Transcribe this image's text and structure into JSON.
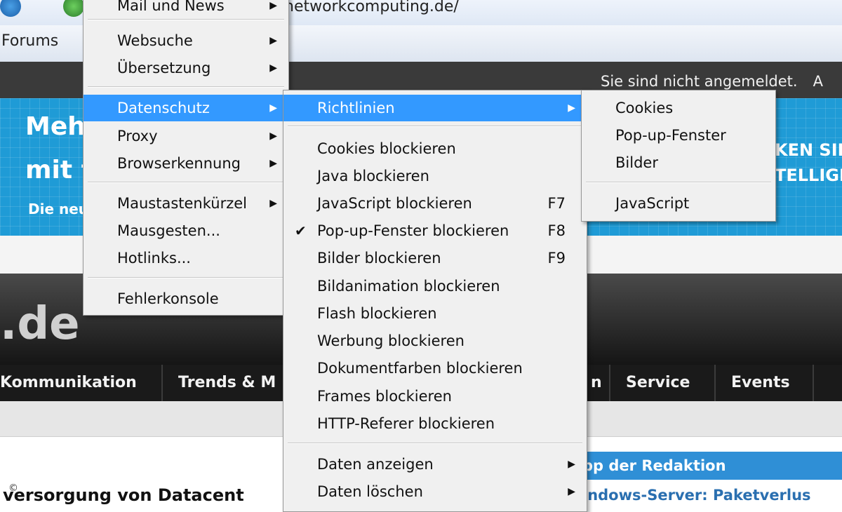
{
  "browser": {
    "address": "networkcomputing.de/",
    "bookmark_label": "Forums"
  },
  "page": {
    "login_status": "Sie sind nicht angemeldet.",
    "login_cut": "A",
    "banner": {
      "line1": "Mehr",
      "line2": "mit f",
      "line3": "Die neu",
      "right1": "KEN SIE,",
      "right2": "TELLIGEN"
    },
    "logo_fragment": ".de",
    "nav": [
      "Kommunikation",
      "Trends & M",
      "n",
      "Service",
      "Events"
    ],
    "headline": "versorgung von Datacent",
    "copyright": "©",
    "tip_header": "pp der Redaktion",
    "tip_text": "indows-Server: Paketverlus"
  },
  "menus": {
    "main": {
      "top_partial": "Mail und News",
      "items": [
        {
          "label": "Websuche",
          "submenu": true
        },
        {
          "label": "Übersetzung",
          "submenu": true
        },
        {
          "label": "Datenschutz",
          "submenu": true,
          "active": true
        },
        {
          "label": "Proxy",
          "submenu": true
        },
        {
          "label": "Browserkennung",
          "submenu": true
        },
        {
          "label": "Maustastenkürzel",
          "submenu": true
        },
        {
          "label": "Mausgesten...",
          "submenu": false
        },
        {
          "label": "Hotlinks...",
          "submenu": false
        },
        {
          "label": "Fehlerkonsole",
          "submenu": false
        }
      ]
    },
    "datenschutz": {
      "items": [
        {
          "label": "Richtlinien",
          "submenu": true,
          "active": true
        },
        {
          "label": "Cookies blockieren"
        },
        {
          "label": "Java blockieren"
        },
        {
          "label": "JavaScript blockieren",
          "shortcut": "F7"
        },
        {
          "label": "Pop-up-Fenster blockieren",
          "shortcut": "F8",
          "checked": true
        },
        {
          "label": "Bilder blockieren",
          "shortcut": "F9"
        },
        {
          "label": "Bildanimation blockieren"
        },
        {
          "label": "Flash blockieren"
        },
        {
          "label": "Werbung blockieren"
        },
        {
          "label": "Dokumentfarben blockieren"
        },
        {
          "label": "Frames blockieren"
        },
        {
          "label": "HTTP-Referer blockieren"
        },
        {
          "label": "Daten anzeigen",
          "submenu": true
        },
        {
          "label": "Daten löschen",
          "submenu": true
        }
      ]
    },
    "richtlinien": {
      "items": [
        {
          "label": "Cookies"
        },
        {
          "label": "Pop-up-Fenster"
        },
        {
          "label": "Bilder"
        },
        {
          "label": "JavaScript"
        }
      ]
    }
  },
  "icons": {
    "arrow": "▶",
    "check": "✔"
  },
  "colors": {
    "highlight": "#3399ff",
    "banner": "#1f9bd6",
    "nav": "#1a1a1a"
  }
}
